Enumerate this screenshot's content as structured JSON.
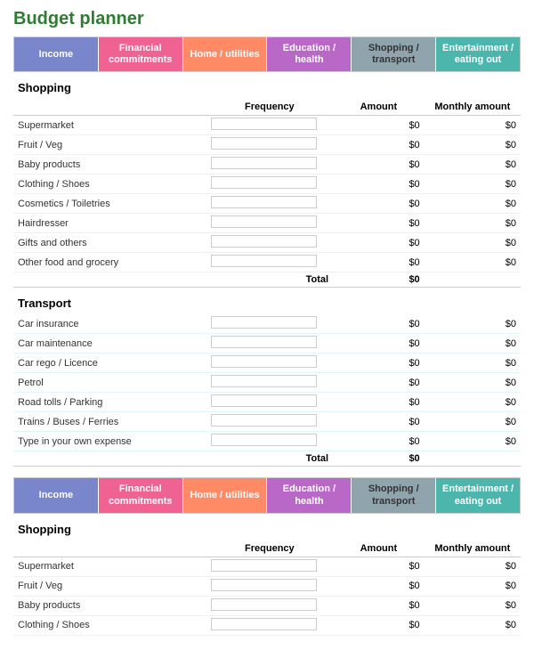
{
  "title": "Budget planner",
  "tabs": [
    {
      "id": "income",
      "label": "Income",
      "class": "tab-income"
    },
    {
      "id": "financial",
      "label": "Financial commitments",
      "class": "tab-financial"
    },
    {
      "id": "home",
      "label": "Home / utilities",
      "class": "tab-home"
    },
    {
      "id": "education",
      "label": "Education / health",
      "class": "tab-education"
    },
    {
      "id": "shopping",
      "label": "Shopping / transport",
      "class": "tab-shopping"
    },
    {
      "id": "entertainment",
      "label": "Entertainment / eating out",
      "class": "tab-entertainment"
    }
  ],
  "section1": {
    "title": "Shopping",
    "headers": {
      "frequency": "Frequency",
      "amount": "Amount",
      "monthly": "Monthly amount"
    },
    "rows": [
      {
        "label": "Supermarket",
        "amount": "$0",
        "monthly": "$0"
      },
      {
        "label": "Fruit / Veg",
        "amount": "$0",
        "monthly": "$0"
      },
      {
        "label": "Baby products",
        "amount": "$0",
        "monthly": "$0"
      },
      {
        "label": "Clothing / Shoes",
        "amount": "$0",
        "monthly": "$0"
      },
      {
        "label": "Cosmetics / Toiletries",
        "amount": "$0",
        "monthly": "$0"
      },
      {
        "label": "Hairdresser",
        "amount": "$0",
        "monthly": "$0"
      },
      {
        "label": "Gifts and others",
        "amount": "$0",
        "monthly": "$0"
      },
      {
        "label": "Other food and grocery",
        "amount": "$0",
        "monthly": "$0"
      }
    ],
    "total": {
      "label": "Total",
      "value": "$0"
    }
  },
  "section2": {
    "title": "Transport",
    "rows": [
      {
        "label": "Car insurance",
        "amount": "$0",
        "monthly": "$0"
      },
      {
        "label": "Car maintenance",
        "amount": "$0",
        "monthly": "$0"
      },
      {
        "label": "Car rego / Licence",
        "amount": "$0",
        "monthly": "$0"
      },
      {
        "label": "Petrol",
        "amount": "$0",
        "monthly": "$0"
      },
      {
        "label": "Road tolls / Parking",
        "amount": "$0",
        "monthly": "$0"
      },
      {
        "label": "Trains / Buses / Ferries",
        "amount": "$0",
        "monthly": "$0"
      },
      {
        "label": "Type in your own expense",
        "amount": "$0",
        "monthly": "$0"
      }
    ],
    "total": {
      "label": "Total",
      "value": "$0"
    }
  },
  "section3": {
    "title": "Shopping",
    "rows": [
      {
        "label": "Supermarket",
        "amount": "$0",
        "monthly": "$0"
      },
      {
        "label": "Fruit / Veg",
        "amount": "$0",
        "monthly": "$0"
      },
      {
        "label": "Baby products",
        "amount": "$0",
        "monthly": "$0"
      },
      {
        "label": "Clothing / Shoes",
        "amount": "$0",
        "monthly": "$0"
      }
    ]
  }
}
